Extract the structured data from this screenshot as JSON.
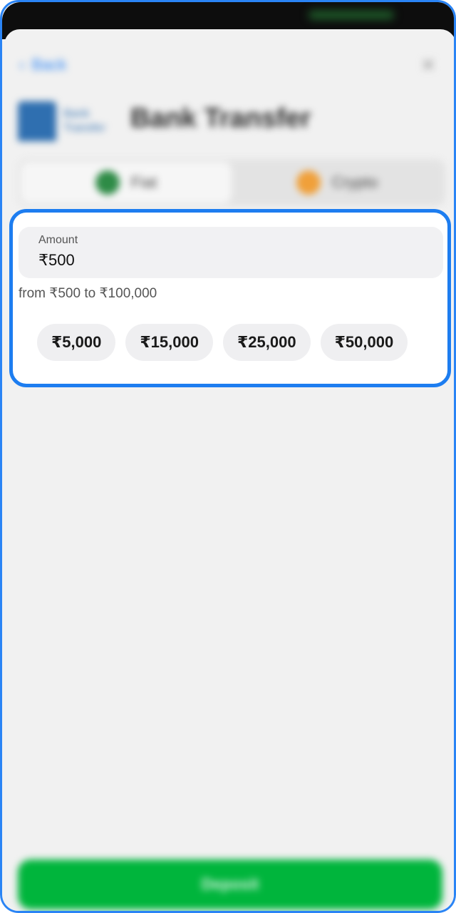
{
  "header": {
    "back_label": "Back",
    "title": "Bank Transfer",
    "logo_text_line1": "Bank",
    "logo_text_line2": "Transfer"
  },
  "tabs": [
    {
      "label": "Fiat",
      "icon": "green-circle-icon",
      "color": "#2e8b46",
      "active": true
    },
    {
      "label": "Crypto",
      "icon": "orange-circle-icon",
      "color": "#f0a03a",
      "active": false
    }
  ],
  "amount": {
    "label": "Amount",
    "value": "₹500",
    "hint": "from ₹500 to ₹100,000"
  },
  "quick_amounts": [
    "₹5,000",
    "₹15,000",
    "₹25,000",
    "₹50,000"
  ],
  "deposit_label": "Deposit",
  "colors": {
    "accent": "#1d7df0",
    "deposit": "#00b53c"
  }
}
